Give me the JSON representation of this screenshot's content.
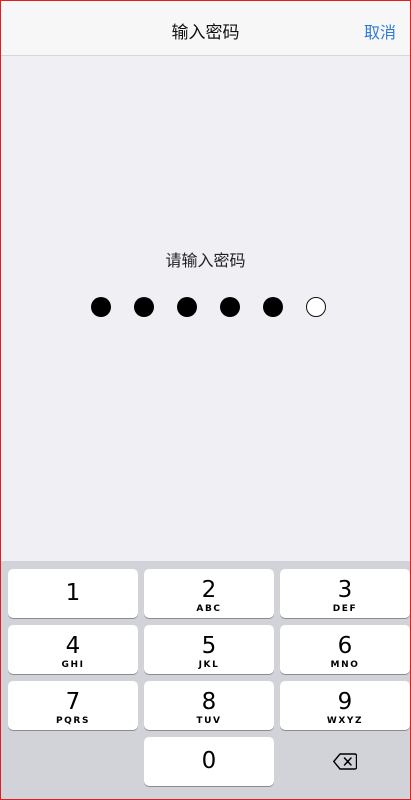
{
  "navbar": {
    "title": "输入密码",
    "cancel_label": "取消"
  },
  "prompt": {
    "text": "请输入密码"
  },
  "passcode": {
    "filled_count": 5,
    "total_length": 6
  },
  "keypad": {
    "keys": [
      {
        "digit": "1",
        "letters": ""
      },
      {
        "digit": "2",
        "letters": "ABC"
      },
      {
        "digit": "3",
        "letters": "DEF"
      },
      {
        "digit": "4",
        "letters": "GHI"
      },
      {
        "digit": "5",
        "letters": "JKL"
      },
      {
        "digit": "6",
        "letters": "MNO"
      },
      {
        "digit": "7",
        "letters": "PQRS"
      },
      {
        "digit": "8",
        "letters": "TUV"
      },
      {
        "digit": "9",
        "letters": "WXYZ"
      },
      {
        "digit": "0",
        "letters": ""
      }
    ],
    "delete_icon": "backspace-icon"
  },
  "colors": {
    "accent": "#2f7ad8",
    "background": "#efeff4",
    "keypad_background": "#d1d3d9",
    "frame_border": "#e02020"
  }
}
